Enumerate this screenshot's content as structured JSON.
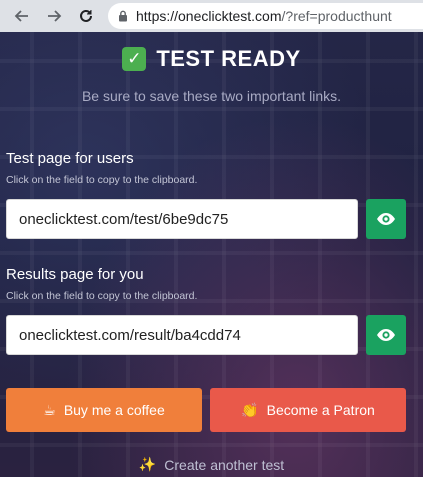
{
  "browser": {
    "url_host": "https://oneclicktest.com",
    "url_query": "/?ref=producthunt"
  },
  "main": {
    "title": "TEST READY",
    "subtitle": "Be sure to save these two important links."
  },
  "users_link": {
    "label": "Test page for users",
    "hint": "Click on the field to copy to the clipboard.",
    "value": "oneclicktest.com/test/6be9dc75"
  },
  "results_link": {
    "label": "Results page for you",
    "hint": "Click on the field to copy to the clipboard.",
    "value": "oneclicktest.com/result/ba4cdd74"
  },
  "buttons": {
    "coffee_label": "Buy me a coffee",
    "patron_label": "Become a Patron",
    "create_label": "Create another test"
  },
  "colors": {
    "check_green": "#4caf50",
    "eye_button": "#1aa260",
    "coffee_button": "#f07f3b",
    "patron_button": "#e9594a"
  },
  "icons": [
    "back-arrow-icon",
    "forward-arrow-icon",
    "reload-icon",
    "lock-icon",
    "check-icon",
    "eye-icon",
    "coffee-icon",
    "clapping-hands-icon",
    "sparkles-icon"
  ]
}
